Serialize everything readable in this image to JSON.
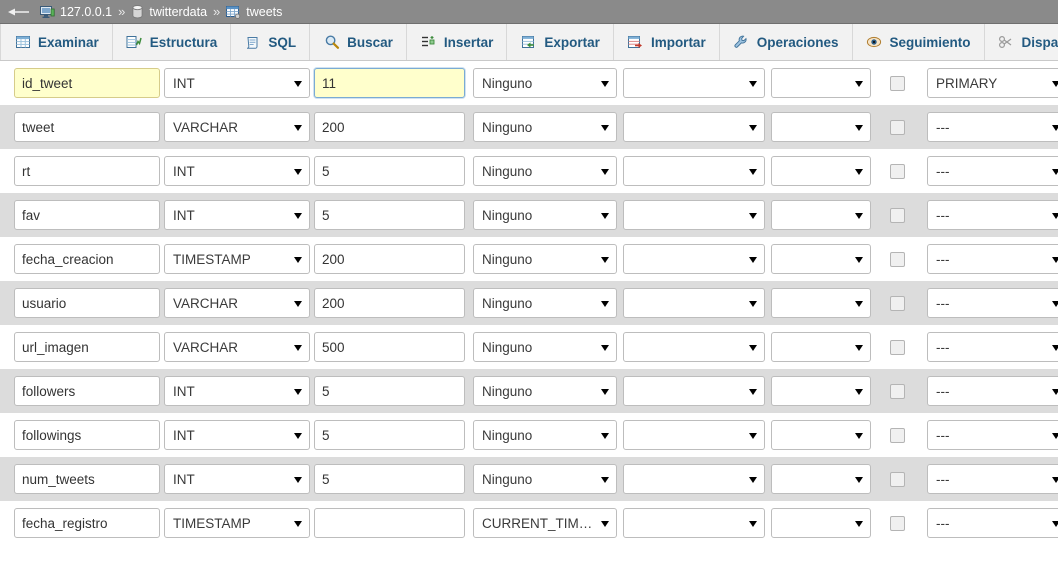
{
  "breadcrumb": {
    "back_label": "back-arrow",
    "items": [
      {
        "label": "127.0.0.1",
        "icon": "server-icon"
      },
      {
        "label": "twitterdata",
        "icon": "database-icon"
      },
      {
        "label": "tweets",
        "icon": "table-icon"
      }
    ],
    "separator": "»"
  },
  "tabs": [
    {
      "label": "Examinar",
      "icon": "browse-icon"
    },
    {
      "label": "Estructura",
      "icon": "structure-icon"
    },
    {
      "label": "SQL",
      "icon": "sql-icon"
    },
    {
      "label": "Buscar",
      "icon": "search-icon"
    },
    {
      "label": "Insertar",
      "icon": "insert-icon"
    },
    {
      "label": "Exportar",
      "icon": "export-icon"
    },
    {
      "label": "Importar",
      "icon": "import-icon"
    },
    {
      "label": "Operaciones",
      "icon": "wrench-icon"
    },
    {
      "label": "Seguimiento",
      "icon": "eye-icon"
    },
    {
      "label": "Disparadores",
      "icon": "triggers-icon"
    }
  ],
  "rows": [
    {
      "name": "id_tweet",
      "type": "INT",
      "length": "11",
      "default": "Ninguno",
      "collation": "",
      "attributes": "",
      "null": false,
      "index": "PRIMARY",
      "highlighted": true,
      "focused_field": "length"
    },
    {
      "name": "tweet",
      "type": "VARCHAR",
      "length": "200",
      "default": "Ninguno",
      "collation": "",
      "attributes": "",
      "null": false,
      "index": "---",
      "highlighted": false,
      "focused_field": ""
    },
    {
      "name": "rt",
      "type": "INT",
      "length": "5",
      "default": "Ninguno",
      "collation": "",
      "attributes": "",
      "null": false,
      "index": "---",
      "highlighted": false,
      "focused_field": ""
    },
    {
      "name": "fav",
      "type": "INT",
      "length": "5",
      "default": "Ninguno",
      "collation": "",
      "attributes": "",
      "null": false,
      "index": "---",
      "highlighted": false,
      "focused_field": ""
    },
    {
      "name": "fecha_creacion",
      "type": "TIMESTAMP",
      "length": "200",
      "default": "Ninguno",
      "collation": "",
      "attributes": "",
      "null": false,
      "index": "---",
      "highlighted": false,
      "focused_field": ""
    },
    {
      "name": "usuario",
      "type": "VARCHAR",
      "length": "200",
      "default": "Ninguno",
      "collation": "",
      "attributes": "",
      "null": false,
      "index": "---",
      "highlighted": false,
      "focused_field": ""
    },
    {
      "name": "url_imagen",
      "type": "VARCHAR",
      "length": "500",
      "default": "Ninguno",
      "collation": "",
      "attributes": "",
      "null": false,
      "index": "---",
      "highlighted": false,
      "focused_field": ""
    },
    {
      "name": "followers",
      "type": "INT",
      "length": "5",
      "default": "Ninguno",
      "collation": "",
      "attributes": "",
      "null": false,
      "index": "---",
      "highlighted": false,
      "focused_field": ""
    },
    {
      "name": "followings",
      "type": "INT",
      "length": "5",
      "default": "Ninguno",
      "collation": "",
      "attributes": "",
      "null": false,
      "index": "---",
      "highlighted": false,
      "focused_field": ""
    },
    {
      "name": "num_tweets",
      "type": "INT",
      "length": "5",
      "default": "Ninguno",
      "collation": "",
      "attributes": "",
      "null": false,
      "index": "---",
      "highlighted": false,
      "focused_field": ""
    },
    {
      "name": "fecha_registro",
      "type": "TIMESTAMP",
      "length": "",
      "default": "CURRENT_TIMESTAMP",
      "collation": "",
      "attributes": "",
      "null": false,
      "index": "---",
      "highlighted": false,
      "focused_field": ""
    }
  ],
  "colors": {
    "breadcrumb_bg": "#8a8a8a",
    "tab_text": "#235a81",
    "tab_bg": "#f2f2f2",
    "row_alt_bg": "#dcdcdc",
    "highlight_bg": "#ffffcc",
    "focus_border": "#7aabd4"
  }
}
